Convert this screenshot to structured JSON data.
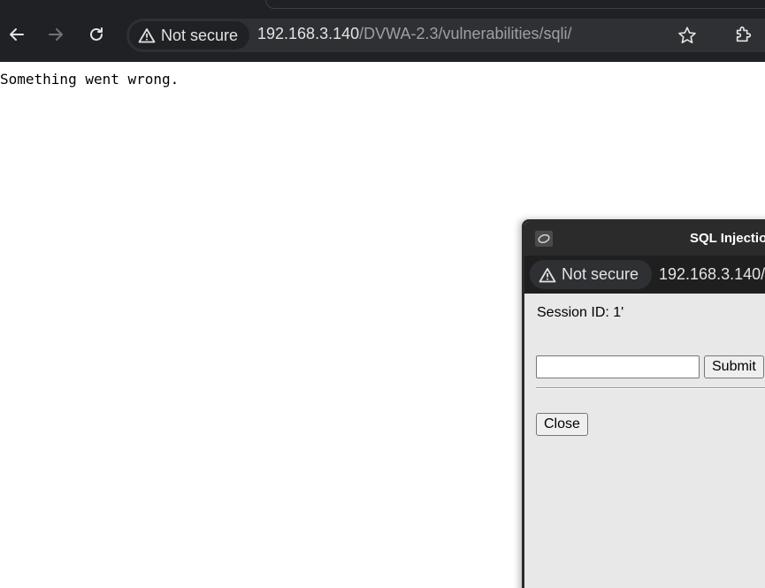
{
  "browser": {
    "security_label": "Not secure",
    "url_host": "192.168.3.140",
    "url_path": "/DVWA-2.3/vulnerabilities/sqli/",
    "icons": [
      "back-arrow-icon",
      "forward-arrow-icon",
      "reload-icon",
      "warning-icon",
      "star-icon",
      "extensions-icon"
    ]
  },
  "page": {
    "message": "Something went wrong."
  },
  "popup": {
    "title": "SQL Injectio",
    "security_label": "Not secure",
    "url": "192.168.3.140/",
    "session_text": "Session ID: 1'",
    "input_value": "",
    "submit_label": "Submit",
    "close_label": "Close"
  }
}
